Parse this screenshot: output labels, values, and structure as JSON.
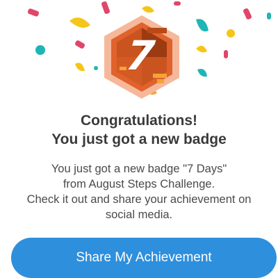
{
  "badge": {
    "number": "7",
    "icon": "hexagon-badge-icon",
    "colors": {
      "outer": "#f6b89a",
      "inner": "#e0622c",
      "dark": "#9c3a12",
      "accent": "#f4a338"
    }
  },
  "confetti": {
    "colors": [
      "#e0456a",
      "#f5c518",
      "#1fb5b5",
      "#f7a43c"
    ]
  },
  "headline": {
    "line1": "Congratulations!",
    "line2": "You just got a new badge"
  },
  "message": {
    "line1": "You just got a new badge \"7 Days\"",
    "line2": "from August Steps Challenge.",
    "line3": "Check it out and share your achievement on",
    "line4": "social media."
  },
  "share_button": {
    "label": "Share My Achievement",
    "color": "#2e8fdd"
  }
}
